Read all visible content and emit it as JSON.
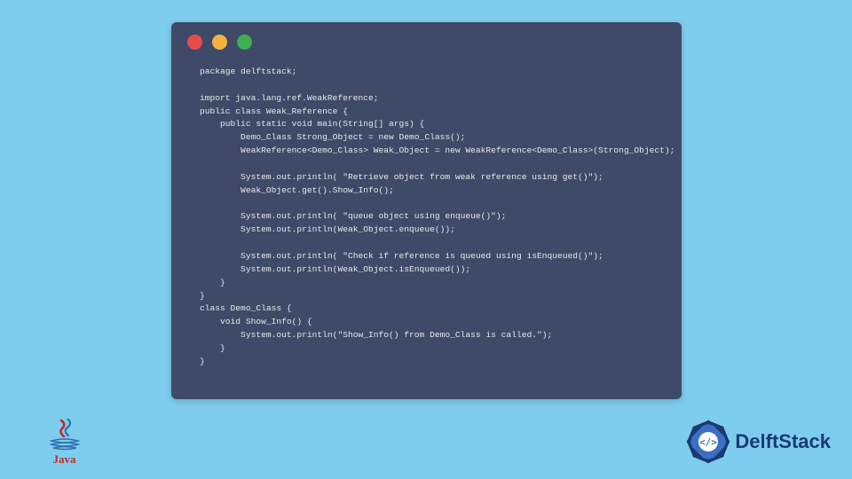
{
  "window": {
    "dot_red": "#e94b4a",
    "dot_yellow": "#f2b43c",
    "dot_green": "#3fae51"
  },
  "code": "package delftstack;\n\nimport java.lang.ref.WeakReference;\npublic class Weak_Reference {\n    public static void main(String[] args) {\n        Demo_Class Strong_Object = new Demo_Class();\n        WeakReference<Demo_Class> Weak_Object = new WeakReference<Demo_Class>(Strong_Object);\n\n        System.out.println( \"Retrieve object from weak reference using get()\");\n        Weak_Object.get().Show_Info();\n\n        System.out.println( \"queue object using enqueue()\");\n        System.out.println(Weak_Object.enqueue());\n\n        System.out.println( \"Check if reference is queued using isEnqueued()\");\n        System.out.println(Weak_Object.isEnqueued());\n    }\n}\nclass Demo_Class {\n    void Show_Info() {\n        System.out.println(\"Show_Info() from Demo_Class is called.\");\n    }\n}",
  "java_logo": {
    "label": "Java"
  },
  "delftstack_logo": {
    "label": "DelftStack"
  }
}
